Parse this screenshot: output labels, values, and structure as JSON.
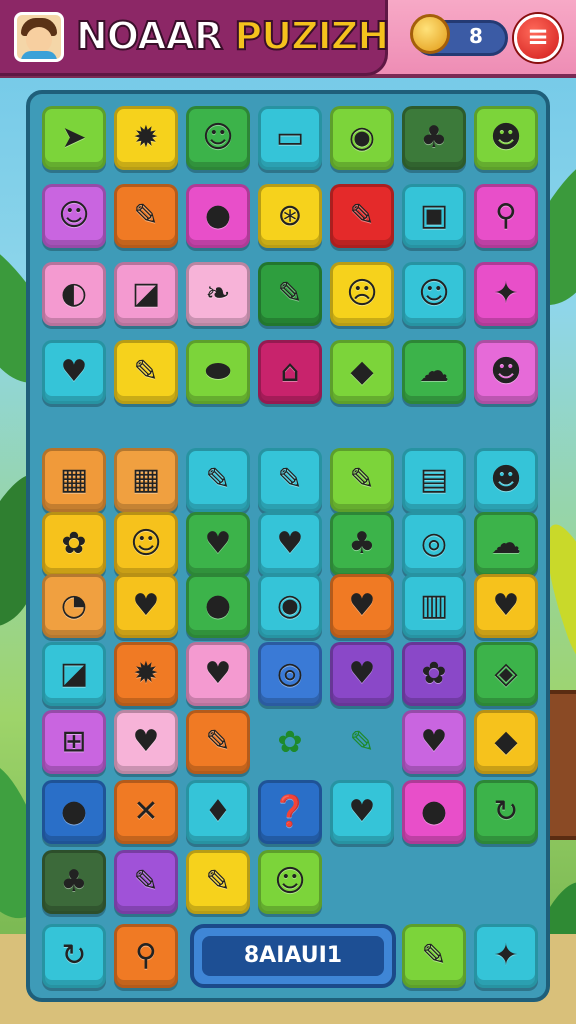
{
  "header": {
    "title_part1": "NOAAR",
    "title_part2": "PUZIZH",
    "coin_count": "8",
    "menu_icon": "≡"
  },
  "board": {
    "top_grid": [
      [
        {
          "color": "#7cd43a",
          "icon": "➤",
          "name": "arrow-icon"
        },
        {
          "color": "#f6d21c",
          "icon": "✹",
          "name": "gear-icon"
        },
        {
          "color": "#3cb34a",
          "icon": "☺",
          "name": "smiley-bubble-icon"
        },
        {
          "color": "#35c4d8",
          "icon": "▭",
          "name": "badge-icon"
        },
        {
          "color": "#7cd43a",
          "icon": "◉",
          "name": "button-icon"
        },
        {
          "color": "#3c7a3a",
          "icon": "♣",
          "name": "bush-icon"
        },
        {
          "color": "#7cd43a",
          "icon": "☻",
          "name": "smiley-icon"
        }
      ],
      [
        {
          "color": "#c965e0",
          "icon": "☺",
          "name": "smiley-pin-icon"
        },
        {
          "color": "#f07a24",
          "icon": "✎",
          "name": "pencil-icon"
        },
        {
          "color": "#e84fc9",
          "icon": "●",
          "name": "ball-icon"
        },
        {
          "color": "#f6d21c",
          "icon": "⊛",
          "name": "compass-icon"
        },
        {
          "color": "#e42a2a",
          "icon": "✎",
          "name": "brush-icon"
        },
        {
          "color": "#35c4d8",
          "icon": "▣",
          "name": "stamp-icon"
        },
        {
          "color": "#e84fc9",
          "icon": "⚲",
          "name": "magnifier-icon"
        }
      ],
      [
        {
          "color": "#f49ad0",
          "icon": "◐",
          "name": "coconut-icon"
        },
        {
          "color": "#f49ad0",
          "icon": "◪",
          "name": "tablet-icon"
        },
        {
          "color": "#f7b3d8",
          "icon": "❧",
          "name": "feather-icon"
        },
        {
          "color": "#2e9e3e",
          "icon": "✎",
          "name": "marker-icon"
        },
        {
          "color": "#f6d21c",
          "icon": "☹",
          "name": "face-ball-icon"
        },
        {
          "color": "#35c4d8",
          "icon": "☺",
          "name": "happy-face-icon"
        },
        {
          "color": "#e84fc9",
          "icon": "✦",
          "name": "sparkle-icon"
        }
      ],
      [
        {
          "color": "#35c4d8",
          "icon": "♥",
          "name": "heart-icon"
        },
        {
          "color": "#f6d21c",
          "icon": "✎",
          "name": "crayon-icon"
        },
        {
          "color": "#7cd43a",
          "icon": "⬬",
          "name": "blob-icon"
        },
        {
          "color": "#c8236c",
          "icon": "⌂",
          "name": "gift-icon"
        },
        {
          "color": "#7cd43a",
          "icon": "◆",
          "name": "leaf-drop-icon"
        },
        {
          "color": "#3cb34a",
          "icon": "☁",
          "name": "cloud-icon"
        },
        {
          "color": "#e66ad8",
          "icon": "☻",
          "name": "monkey-icon"
        }
      ]
    ],
    "bottom_grid": [
      [
        {
          "color": "#f09a3a",
          "icon": "▦",
          "name": "calendar-icon"
        },
        {
          "color": "#f0a040",
          "icon": "▦",
          "name": "grid-icon"
        },
        {
          "color": "#35c4d8",
          "icon": "✎",
          "name": "pencil-icon"
        },
        {
          "color": "#35c4d8",
          "icon": "✎",
          "name": "marker-icon"
        },
        {
          "color": "#7cd43a",
          "icon": "✎",
          "name": "red-pen-icon"
        },
        {
          "color": "#35c4d8",
          "icon": "▤",
          "name": "phone-icon"
        },
        {
          "color": "#35c4d8",
          "icon": "☻",
          "name": "smiley-icon"
        }
      ],
      [
        {
          "color": "#f6c21c",
          "icon": "✿",
          "name": "flower-icon"
        },
        {
          "color": "#f6c21c",
          "icon": "☺",
          "name": "face-icon"
        },
        {
          "color": "#3cb34a",
          "icon": "♥",
          "name": "heart-icon"
        },
        {
          "color": "#35c4d8",
          "icon": "♥",
          "name": "heart-icon"
        },
        {
          "color": "#3cb34a",
          "icon": "♣",
          "name": "bush-icon"
        },
        {
          "color": "#35c4d8",
          "icon": "◎",
          "name": "target-icon"
        },
        {
          "color": "#3cb34a",
          "icon": "☁",
          "name": "ghost-icon"
        }
      ],
      [
        {
          "color": "#f0a040",
          "icon": "◔",
          "name": "clock-icon"
        },
        {
          "color": "#f6c21c",
          "icon": "♥",
          "name": "heart-icon"
        },
        {
          "color": "#3cb34a",
          "icon": "●",
          "name": "ball-icon"
        },
        {
          "color": "#35c4d8",
          "icon": "◉",
          "name": "eye-icon"
        },
        {
          "color": "#f07a24",
          "icon": "♥",
          "name": "heart-icon"
        },
        {
          "color": "#35c4d8",
          "icon": "▥",
          "name": "box-icon"
        },
        {
          "color": "#f6c21c",
          "icon": "♥",
          "name": "red-heart-icon"
        }
      ],
      [
        {
          "color": "#35c4d8",
          "icon": "◪",
          "name": "card-icon"
        },
        {
          "color": "#f07a24",
          "icon": "✹",
          "name": "sun-face-icon"
        },
        {
          "color": "#f49ad0",
          "icon": "♥",
          "name": "heart-icon"
        },
        {
          "color": "#3a7ad6",
          "icon": "◎",
          "name": "coil-icon"
        },
        {
          "color": "#8a48c8",
          "icon": "♥",
          "name": "heart-icon"
        },
        {
          "color": "#8a48c8",
          "icon": "✿",
          "name": "splat-icon"
        },
        {
          "color": "#3cb34a",
          "icon": "◈",
          "name": "chip-icon"
        }
      ],
      [
        {
          "color": "#c965e0",
          "icon": "⊞",
          "name": "frame-icon"
        },
        {
          "color": "#f7b3d8",
          "icon": "♥",
          "name": "heart-icon"
        },
        {
          "color": "#f07a24",
          "icon": "✎",
          "name": "pen-icon"
        },
        null,
        null,
        {
          "color": "#c965e0",
          "icon": "♥",
          "name": "heart-icon"
        },
        {
          "color": "#f6c21c",
          "icon": "◆",
          "name": "candy-icon"
        }
      ],
      [
        {
          "color": "#2a6fc8",
          "icon": "●",
          "name": "green-ball-icon"
        },
        {
          "color": "#f07a24",
          "icon": "✕",
          "name": "cross-icon"
        },
        {
          "color": "#35c4d8",
          "icon": "♦",
          "name": "balloon-icon"
        },
        {
          "color": "#2a6fc8",
          "icon": "❓",
          "name": "question-icon"
        },
        {
          "color": "#35c4d8",
          "icon": "♥",
          "name": "heart-icon"
        },
        {
          "color": "#e84fc9",
          "icon": "●",
          "name": "fruit-icon"
        },
        {
          "color": "#3cb34a",
          "icon": "↻",
          "name": "refresh-icon"
        }
      ],
      [
        {
          "color": "#3c6a3a",
          "icon": "♣",
          "name": "bush-icon"
        },
        {
          "color": "#a052d8",
          "icon": "✎",
          "name": "marker-icon"
        },
        {
          "color": "#f6d21c",
          "icon": "✎",
          "name": "red-marker-icon"
        },
        {
          "color": "#7cd43a",
          "icon": "☺",
          "name": "chick-icon"
        },
        null,
        null,
        null
      ]
    ],
    "loose_pieces": [
      {
        "icon": "✿",
        "name": "loose-leaf-icon"
      },
      {
        "icon": "✎",
        "name": "loose-pencil-icon"
      }
    ],
    "bottom_row": {
      "left_buttons": [
        {
          "color": "#35c4d8",
          "icon": "↻",
          "name": "refresh-button"
        },
        {
          "color": "#f07a24",
          "icon": "⚲",
          "name": "search-button"
        }
      ],
      "center_label": "8AIAUI1",
      "right_buttons": [
        {
          "color": "#7cd43a",
          "icon": "✎",
          "name": "pencil-button"
        },
        {
          "color": "#35c4d8",
          "icon": "✦",
          "name": "hint-button"
        }
      ]
    }
  }
}
